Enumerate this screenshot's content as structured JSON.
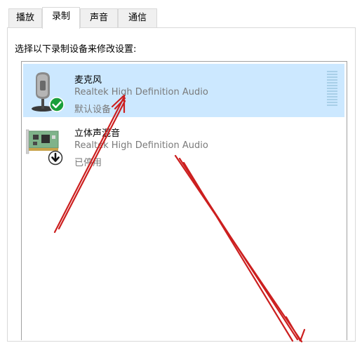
{
  "tabs": [
    {
      "label": "播放"
    },
    {
      "label": "录制",
      "active": true
    },
    {
      "label": "声音"
    },
    {
      "label": "通信"
    }
  ],
  "instruction": "选择以下录制设备来修改设置:",
  "devices": [
    {
      "name": "麦克风",
      "driver": "Realtek High Definition Audio",
      "status": "默认设备",
      "icon": "microphone-icon",
      "badge": "green-check-icon",
      "selected": true
    },
    {
      "name": "立体声混音",
      "driver": "Realtek High Definition Audio",
      "status": "已停用",
      "icon": "sound-card-icon",
      "badge": "disabled-down-arrow-icon",
      "selected": false
    }
  ],
  "colors": {
    "selection": "#cce8ff",
    "check_badge": "#1a9e3a",
    "arrow_annotation": "#cc1f1f",
    "secondary_text": "#7a7a7a"
  }
}
